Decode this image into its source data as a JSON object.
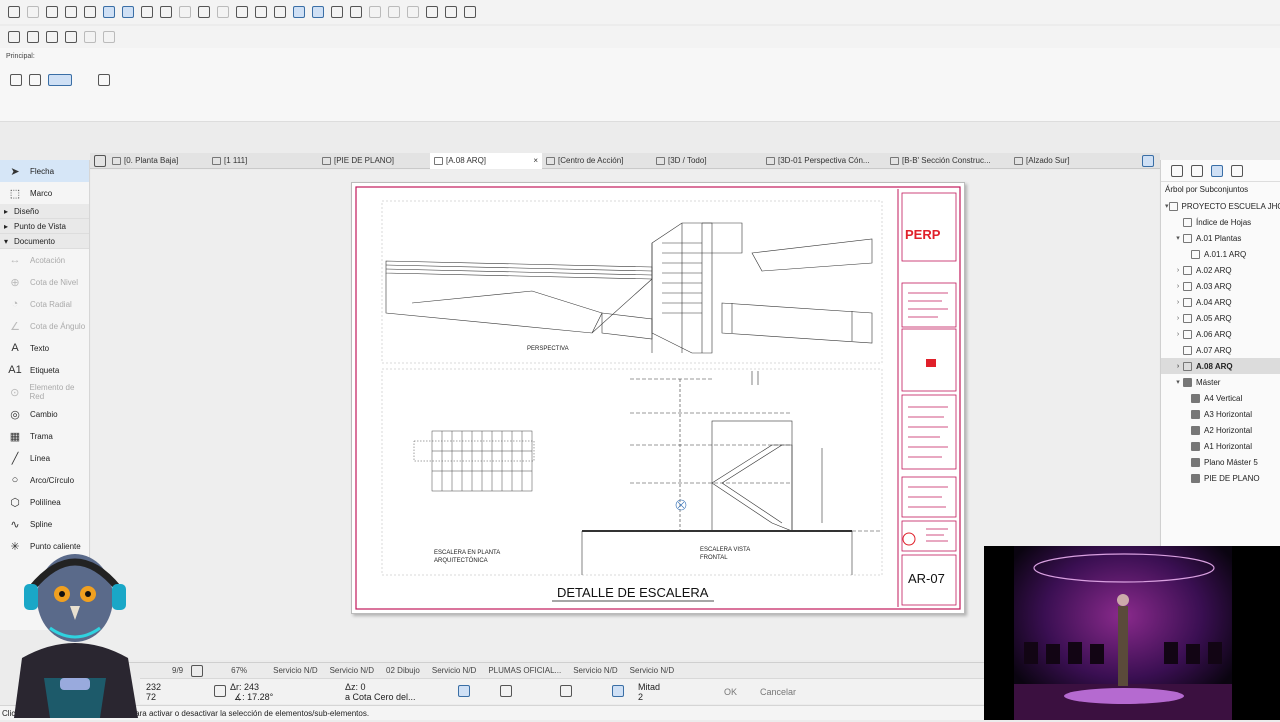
{
  "infobox": {
    "label": "Principal:"
  },
  "tabs": [
    {
      "label": "[0. Planta Baja]"
    },
    {
      "label": "[1 111]"
    },
    {
      "label": "[PIE DE PLANO]"
    },
    {
      "label": "[A.08 ARQ]",
      "close": "×"
    },
    {
      "label": "[Centro de Acción]"
    },
    {
      "label": "[3D / Todo]"
    },
    {
      "label": "[3D-01 Perspectiva Cón..."
    },
    {
      "label": "[B-B' Sección Construc..."
    },
    {
      "label": "[Alzado Sur]"
    }
  ],
  "toolbox": {
    "top_items": [
      {
        "icon": "arrow-icon",
        "label": "Flecha"
      },
      {
        "icon": "marquee-icon",
        "label": "Marco"
      }
    ],
    "sections": [
      {
        "label": "Diseño"
      },
      {
        "label": "Punto de Vista"
      },
      {
        "label": "Documento"
      }
    ],
    "items": [
      {
        "icon": "dimension-icon",
        "label": "Acotación",
        "dim": true
      },
      {
        "icon": "level-dimension-icon",
        "label": "Cota de Nivel",
        "dim": true
      },
      {
        "icon": "radial-dimension-icon",
        "label": "Cota Radial",
        "dim": true
      },
      {
        "icon": "angle-dimension-icon",
        "label": "Cota de Ángulo",
        "dim": true
      },
      {
        "icon": "text-icon",
        "label": "Texto",
        "dim": false
      },
      {
        "icon": "label-icon",
        "label": "Etiqueta",
        "dim": false
      },
      {
        "icon": "grid-element-icon",
        "label": "Elemento de Red",
        "dim": true
      },
      {
        "icon": "change-icon",
        "label": "Cambio",
        "dim": false
      },
      {
        "icon": "fill-icon",
        "label": "Trama",
        "dim": false
      },
      {
        "icon": "line-icon",
        "label": "Línea",
        "dim": false
      },
      {
        "icon": "arc-icon",
        "label": "Arco/Círculo",
        "dim": false
      },
      {
        "icon": "polyline-icon",
        "label": "Polilínea",
        "dim": false
      },
      {
        "icon": "spline-icon",
        "label": "Spline",
        "dim": false
      },
      {
        "icon": "hotspot-icon",
        "label": "Punto caliente",
        "dim": false
      }
    ]
  },
  "sheet": {
    "title": "DETALLE DE ESCALERA",
    "caption_perspective": "PERSPECTIVA",
    "caption_plan": [
      "ESCALERA EN PLANTA",
      "ARQUITECTÓNICA"
    ],
    "caption_front": [
      "ESCALERA VISTA",
      "FRONTAL"
    ],
    "logo_text": "PERP",
    "sheet_number": "AR-07",
    "colors": {
      "border": "#c2185b",
      "accent": "#e0202a"
    }
  },
  "navigator": {
    "dropdown": "Árbol por Subconjuntos",
    "rows": [
      {
        "label": "PROYECTO ESCUELA JHON...",
        "level": 0,
        "arrow": "▾",
        "icon": "project-icon"
      },
      {
        "label": "Índice de Hojas",
        "level": 1,
        "arrow": "",
        "icon": "sheet-index-icon"
      },
      {
        "label": "A.01 Plantas",
        "level": 1,
        "arrow": "▾",
        "icon": "subset-icon"
      },
      {
        "label": "A.01.1 ARQ",
        "level": 2,
        "arrow": "",
        "icon": "layout-icon"
      },
      {
        "label": "A.02 ARQ",
        "level": 1,
        "arrow": "›",
        "icon": "layout-icon"
      },
      {
        "label": "A.03 ARQ",
        "level": 1,
        "arrow": "›",
        "icon": "layout-icon"
      },
      {
        "label": "A.04 ARQ",
        "level": 1,
        "arrow": "›",
        "icon": "layout-icon"
      },
      {
        "label": "A.05 ARQ",
        "level": 1,
        "arrow": "›",
        "icon": "layout-icon"
      },
      {
        "label": "A.06 ARQ",
        "level": 1,
        "arrow": "›",
        "icon": "layout-icon"
      },
      {
        "label": "A.07 ARQ",
        "level": 1,
        "arrow": "",
        "icon": "layout-icon"
      },
      {
        "label": "A.08 ARQ",
        "level": 1,
        "arrow": "›",
        "icon": "layout-icon",
        "selected": true
      },
      {
        "label": "Máster",
        "level": 1,
        "arrow": "▾",
        "icon": "folder-icon"
      },
      {
        "label": "A4 Vertical",
        "level": 2,
        "arrow": "",
        "icon": "master-icon"
      },
      {
        "label": "A3 Horizontal",
        "level": 2,
        "arrow": "",
        "icon": "master-icon"
      },
      {
        "label": "A2 Horizontal",
        "level": 2,
        "arrow": "",
        "icon": "master-icon"
      },
      {
        "label": "A1 Horizontal",
        "level": 2,
        "arrow": "",
        "icon": "master-icon"
      },
      {
        "label": "Plano Máster 5",
        "level": 2,
        "arrow": "",
        "icon": "master-icon"
      },
      {
        "label": "PIE DE PLANO",
        "level": 2,
        "arrow": "",
        "icon": "master-icon"
      }
    ]
  },
  "statusbar": {
    "page": "9/9",
    "zoom": "67%",
    "layer1": "Servicio N/D",
    "layer2": "Servicio N/D",
    "scale": "02 Dibujo",
    "layer3": "Servicio N/D",
    "pens": "PLUMAS OFICIAL...",
    "layer4": "Servicio N/D",
    "layer5": "Servicio N/D"
  },
  "coords": {
    "x_val": "232",
    "y_val": "72",
    "dr": "Δr: 243",
    "angle": "∡: 17.28°",
    "dz": "Δz: 0",
    "ref": "a Cota Cero del...",
    "mid_label": "Mitad",
    "mid_val": "2",
    "ok": "OK",
    "cancel": "Cancelar"
  },
  "message": "Clic ... Selección. Pulse Ctrl+Mayús para activar o desactivar la selección de elementos/sub-elementos."
}
